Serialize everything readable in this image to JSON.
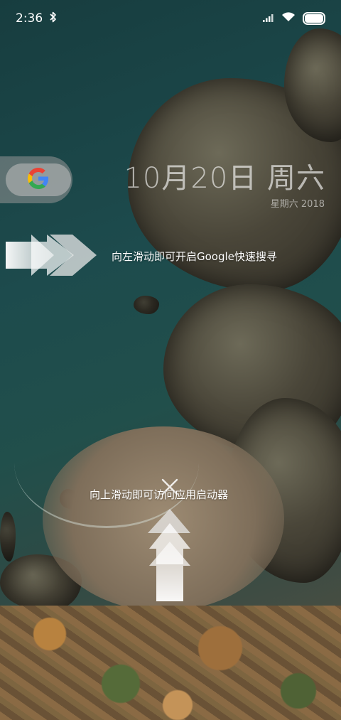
{
  "status_bar": {
    "time": "2:36",
    "bluetooth_icon": "bluetooth-icon",
    "signal_icon": "signal-icon",
    "wifi_icon": "wifi-icon",
    "battery_icon": "battery-icon",
    "battery_level": 1.0
  },
  "google_widget": {
    "icon": "google-g-icon"
  },
  "date": {
    "main": "10月20日 周六",
    "sub": "星期六 2018"
  },
  "hints": {
    "swipe_left_text": "向左滑动即可开启Google快速搜寻",
    "swipe_up_text": "向上滑动即可访问应用启动器",
    "left_arrows_icon": "swipe-left-arrows-icon",
    "up_arrows_icon": "swipe-up-arrows-icon",
    "close_icon": "close-icon"
  },
  "colors": {
    "google_blue": "#4285F4",
    "google_red": "#EA4335",
    "google_yellow": "#FBBC05",
    "google_green": "#34A853"
  }
}
